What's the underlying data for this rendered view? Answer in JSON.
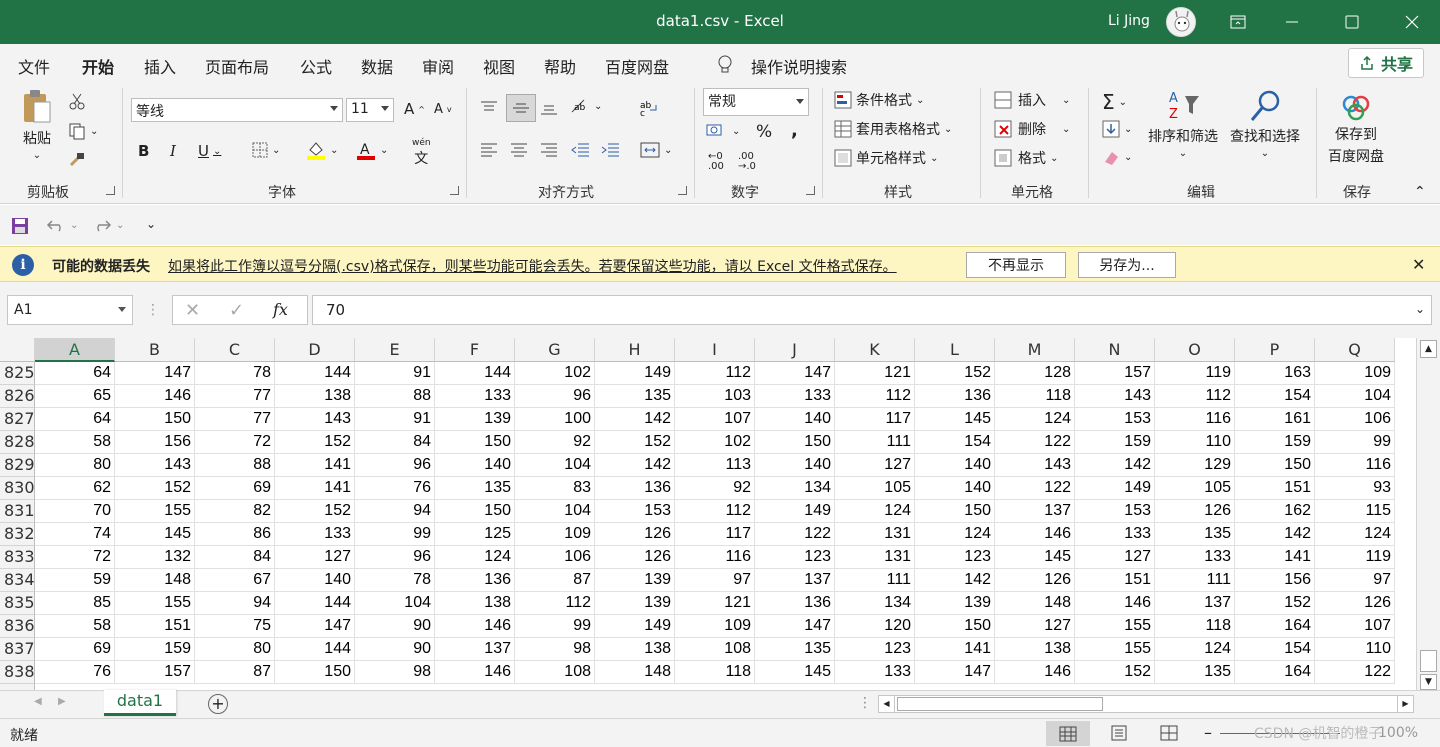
{
  "window": {
    "title": "data1.csv  -  Excel",
    "user": "Li Jing"
  },
  "tabs": [
    "文件",
    "开始",
    "插入",
    "页面布局",
    "公式",
    "数据",
    "审阅",
    "视图",
    "帮助",
    "百度网盘"
  ],
  "active_tab": "开始",
  "tell_me": "操作说明搜索",
  "share_label": "共享",
  "ribbon": {
    "clipboard": {
      "paste": "粘贴",
      "label": "剪贴板"
    },
    "font": {
      "name": "等线",
      "size": "11",
      "label": "字体",
      "phonetic": "wén"
    },
    "alignment": {
      "label": "对齐方式"
    },
    "number": {
      "format": "常规",
      "label": "数字",
      "percent": "%",
      "comma": ","
    },
    "styles": {
      "conditional": "条件格式",
      "table": "套用表格格式",
      "cell": "单元格样式",
      "label": "样式"
    },
    "cells": {
      "insert": "插入",
      "delete": "删除",
      "format": "格式",
      "label": "单元格"
    },
    "editing": {
      "sort": "排序和筛选",
      "find": "查找和选择",
      "label": "编辑"
    },
    "save": {
      "line1": "保存到",
      "line2": "百度网盘",
      "label": "保存"
    }
  },
  "message_bar": {
    "title": "可能的数据丢失",
    "text": "如果将此工作簿以逗号分隔(.csv)格式保存，则某些功能可能会丢失。若要保留这些功能，请以 Excel 文件格式保存。",
    "btn_dismiss": "不再显示",
    "btn_saveas": "另存为..."
  },
  "formula_bar": {
    "name_box": "A1",
    "fx": "fx",
    "value": "70"
  },
  "columns": [
    "A",
    "B",
    "C",
    "D",
    "E",
    "F",
    "G",
    "H",
    "I",
    "J",
    "K",
    "L",
    "M",
    "N",
    "O",
    "P",
    "Q"
  ],
  "rows": [
    {
      "n": "825",
      "v": [
        "64",
        "147",
        "78",
        "144",
        "91",
        "144",
        "102",
        "149",
        "112",
        "147",
        "121",
        "152",
        "128",
        "157",
        "119",
        "163",
        "109"
      ]
    },
    {
      "n": "826",
      "v": [
        "65",
        "146",
        "77",
        "138",
        "88",
        "133",
        "96",
        "135",
        "103",
        "133",
        "112",
        "136",
        "118",
        "143",
        "112",
        "154",
        "104"
      ]
    },
    {
      "n": "827",
      "v": [
        "64",
        "150",
        "77",
        "143",
        "91",
        "139",
        "100",
        "142",
        "107",
        "140",
        "117",
        "145",
        "124",
        "153",
        "116",
        "161",
        "106"
      ]
    },
    {
      "n": "828",
      "v": [
        "58",
        "156",
        "72",
        "152",
        "84",
        "150",
        "92",
        "152",
        "102",
        "150",
        "111",
        "154",
        "122",
        "159",
        "110",
        "159",
        "99"
      ]
    },
    {
      "n": "829",
      "v": [
        "80",
        "143",
        "88",
        "141",
        "96",
        "140",
        "104",
        "142",
        "113",
        "140",
        "127",
        "140",
        "143",
        "142",
        "129",
        "150",
        "116"
      ]
    },
    {
      "n": "830",
      "v": [
        "62",
        "152",
        "69",
        "141",
        "76",
        "135",
        "83",
        "136",
        "92",
        "134",
        "105",
        "140",
        "122",
        "149",
        "105",
        "151",
        "93"
      ]
    },
    {
      "n": "831",
      "v": [
        "70",
        "155",
        "82",
        "152",
        "94",
        "150",
        "104",
        "153",
        "112",
        "149",
        "124",
        "150",
        "137",
        "153",
        "126",
        "162",
        "115"
      ]
    },
    {
      "n": "832",
      "v": [
        "74",
        "145",
        "86",
        "133",
        "99",
        "125",
        "109",
        "126",
        "117",
        "122",
        "131",
        "124",
        "146",
        "133",
        "135",
        "142",
        "124"
      ]
    },
    {
      "n": "833",
      "v": [
        "72",
        "132",
        "84",
        "127",
        "96",
        "124",
        "106",
        "126",
        "116",
        "123",
        "131",
        "123",
        "145",
        "127",
        "133",
        "141",
        "119"
      ]
    },
    {
      "n": "834",
      "v": [
        "59",
        "148",
        "67",
        "140",
        "78",
        "136",
        "87",
        "139",
        "97",
        "137",
        "111",
        "142",
        "126",
        "151",
        "111",
        "156",
        "97"
      ]
    },
    {
      "n": "835",
      "v": [
        "85",
        "155",
        "94",
        "144",
        "104",
        "138",
        "112",
        "139",
        "121",
        "136",
        "134",
        "139",
        "148",
        "146",
        "137",
        "152",
        "126"
      ]
    },
    {
      "n": "836",
      "v": [
        "58",
        "151",
        "75",
        "147",
        "90",
        "146",
        "99",
        "149",
        "109",
        "147",
        "120",
        "150",
        "127",
        "155",
        "118",
        "164",
        "107"
      ]
    },
    {
      "n": "837",
      "v": [
        "69",
        "159",
        "80",
        "144",
        "90",
        "137",
        "98",
        "138",
        "108",
        "135",
        "123",
        "141",
        "138",
        "155",
        "124",
        "154",
        "110"
      ]
    },
    {
      "n": "838",
      "v": [
        "76",
        "157",
        "87",
        "150",
        "98",
        "146",
        "108",
        "148",
        "118",
        "145",
        "133",
        "147",
        "146",
        "152",
        "135",
        "164",
        "122"
      ]
    }
  ],
  "sheet_tab": "data1",
  "status": {
    "ready": "就绪",
    "zoom": "100%",
    "watermark": "CSDN @机智的橙子"
  },
  "colors": {
    "accent": "#217346",
    "msgbar": "#fdf6c3"
  }
}
